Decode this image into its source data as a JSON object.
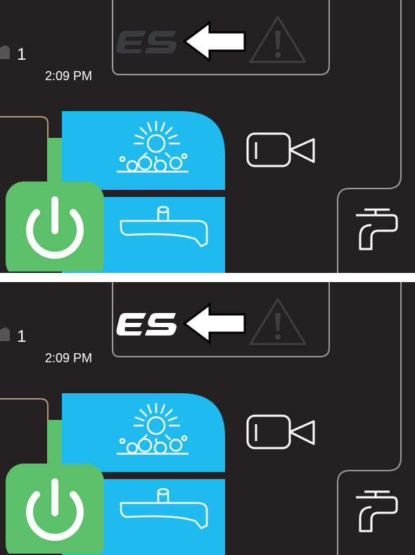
{
  "panels": [
    {
      "state": "eco-mode-inactive",
      "status": {
        "count": "1",
        "time": "2:09 PM"
      },
      "icons": [
        "es-eco-icon",
        "arrow-left-icon",
        "warning-icon",
        "camera-icon",
        "faucet-icon",
        "power-icon",
        "sun-wash-icon",
        "squeegee-icon"
      ],
      "es_indicator": {
        "state": "inactive",
        "color": "#3a3d40"
      }
    },
    {
      "state": "eco-mode-active",
      "status": {
        "count": "1",
        "time": "2:09 PM"
      },
      "icons": [
        "es-eco-icon",
        "arrow-left-icon",
        "warning-icon",
        "camera-icon",
        "faucet-icon",
        "power-icon",
        "sun-wash-icon",
        "squeegee-icon"
      ],
      "es_indicator": {
        "state": "active",
        "color": "#ffffff"
      }
    }
  ],
  "colors": {
    "background": "#252122",
    "blue_button": "#1ebbee",
    "power_green": "#5cbf6a",
    "frame_gray": "#9a9a9a",
    "tan_outline": "#b89670"
  }
}
